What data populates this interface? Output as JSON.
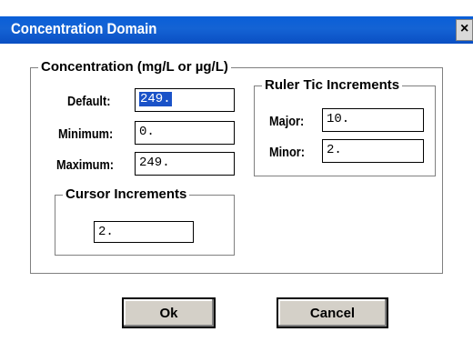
{
  "window": {
    "title": "Concentration Domain",
    "close_glyph": "×"
  },
  "concentration": {
    "legend": "Concentration (mg/L or µg/L)",
    "default_label": "Default:",
    "default_value": "249.",
    "minimum_label": "Minimum:",
    "minimum_value": "0.",
    "maximum_label": "Maximum:",
    "maximum_value": "249."
  },
  "cursor_increments": {
    "legend": "Cursor Increments",
    "value": "2."
  },
  "ruler": {
    "legend": "Ruler Tic Increments",
    "major_label": "Major:",
    "major_value": "10.",
    "minor_label": "Minor:",
    "minor_value": "2."
  },
  "buttons": {
    "ok": "Ok",
    "cancel": "Cancel"
  }
}
